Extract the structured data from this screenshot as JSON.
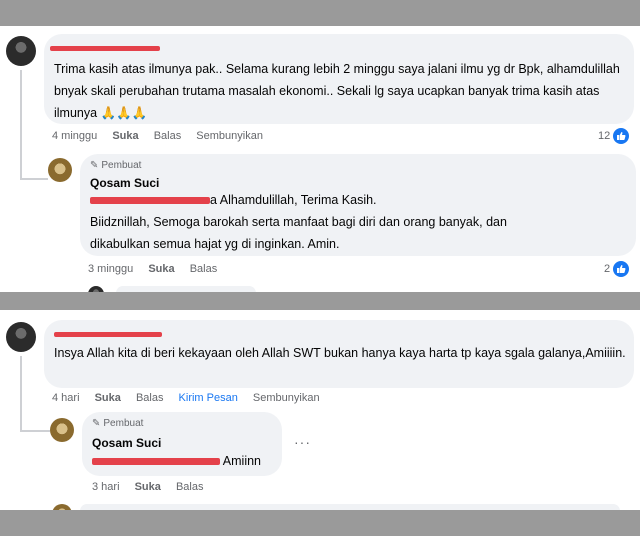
{
  "comment1": {
    "text": "Trima kasih atas ilmunya pak.. Selama kurang lebih 2 minggu saya jalani ilmu yg dr Bpk, alhamdulillah bnyak skali perubahan trutama masalah ekonomi.. Sekali lg saya ucapkan banyak trima kasih atas ilmunya 🙏🙏🙏",
    "time": "4 minggu",
    "like_label": "Suka",
    "reply_label": "Balas",
    "hide_label": "Sembunyikan",
    "reaction_count": "12"
  },
  "reply1": {
    "badge": "Pembuat",
    "author": "Qosam Suci",
    "line1_suffix": "a Alhamdulillah, Terima Kasih.",
    "line2": "Biidznillah, Semoga barokah serta manfaat bagi diri dan orang banyak, dan",
    "line3": "dikabulkan semua hajat yg di inginkan. Amin.",
    "time": "3 minggu",
    "like_label": "Suka",
    "reply_label": "Balas",
    "reaction_count": "2"
  },
  "comment2": {
    "text": "Insya Allah kita di beri kekayaan oleh Allah SWT bukan hanya kaya harta tp kaya sgala galanya,Amiiiin.",
    "time": "4 hari",
    "like_label": "Suka",
    "reply_label": "Balas",
    "message_label": "Kirim Pesan",
    "hide_label": "Sembunyikan"
  },
  "reply2": {
    "badge": "Pembuat",
    "author": "Qosam Suci",
    "text_suffix": "Amiinn",
    "time": "3 hari",
    "like_label": "Suka",
    "reply_label": "Balas",
    "more_label": "···"
  },
  "colors": {
    "link_blue": "#1877f2",
    "bubble_bg": "#f0f2f5",
    "redaction": "#e4414a",
    "band": "#9a9a9a"
  },
  "icons": [
    "like-icon",
    "pencil-icon",
    "more-options-icon"
  ]
}
